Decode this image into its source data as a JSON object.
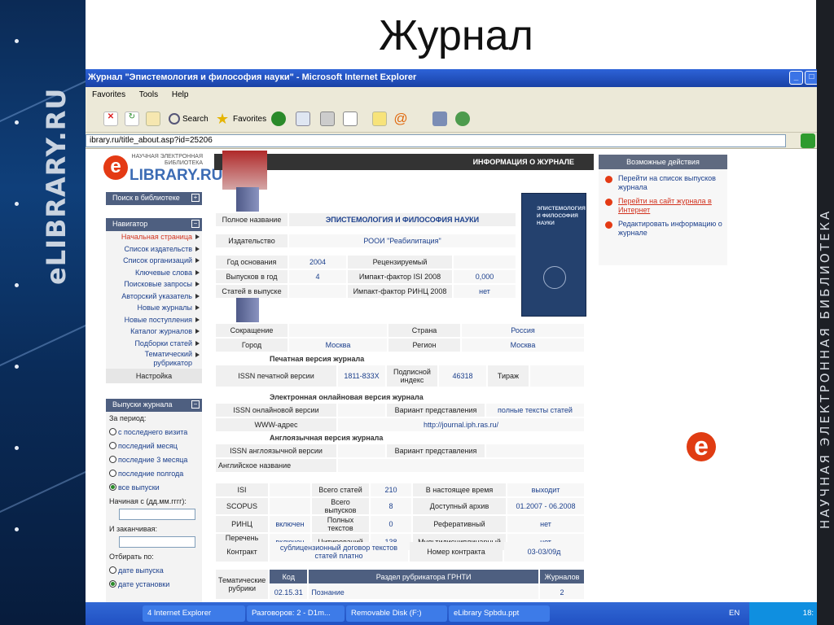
{
  "slide": {
    "title": "Журнал",
    "left_logo": "eLIBRARY.RU",
    "right_text": "НАУЧНАЯ ЭЛЕКТРОННАЯ БИБЛИОТЕКА"
  },
  "window": {
    "title": "Журнал \"Эпистемология и философия науки\" - Microsoft Internet Explorer",
    "menu": [
      "Favorites",
      "Tools",
      "Help"
    ],
    "toolbar": {
      "search": "Search",
      "favorites": "Favorites"
    },
    "address": "ibrary.ru/title_about.asp?id=25206"
  },
  "elibrary_logo": {
    "caption": "НАУЧНАЯ ЭЛЕКТРОННАЯ БИБЛИОТЕКА",
    "name": "LIBRARY.RU",
    "mark": "e"
  },
  "sidebar": {
    "search_label": "Поиск в библиотеке",
    "nav_label": "Навигатор",
    "nav_items": [
      {
        "label": "Начальная страница",
        "active": true
      },
      {
        "label": "Список издательств"
      },
      {
        "label": "Список организаций"
      },
      {
        "label": "Ключевые слова"
      },
      {
        "label": "Поисковые запросы"
      },
      {
        "label": "Авторский указатель"
      },
      {
        "label": "Новые журналы"
      },
      {
        "label": "Новые поступления"
      },
      {
        "label": "Каталог журналов"
      },
      {
        "label": "Подборки статей"
      },
      {
        "label": "Тематический рубрикатор"
      },
      {
        "label": "Настройка"
      }
    ],
    "issues_label": "Выпуски журнала",
    "period_label": "За период:",
    "periods": [
      "с последнего визита",
      "последний месяц",
      "последние 3 месяца",
      "последние полгода",
      "все выпуски"
    ],
    "start_label": "Начиная с (дд.мм.гггг):",
    "end_label": "И заканчивая:",
    "sort_label": "Отбирать по:",
    "sort_options": [
      "дате выпуска",
      "дате установки"
    ]
  },
  "info": {
    "band_title": "ИНФОРМАЦИЯ О ЖУРНАЛЕ",
    "full_name_label": "Полное название",
    "full_name": "ЭПИСТЕМОЛОГИЯ И ФИЛОСОФИЯ НАУКИ",
    "publisher_label": "Издательство",
    "publisher": "РООИ \"Реабилитация\"",
    "founded_label": "Год основания",
    "founded": "2004",
    "reviewed": "Рецензируемый",
    "issues_year_label": "Выпусков в год",
    "issues_year": "4",
    "isi_if_label": "Импакт-фактор ISI 2008",
    "isi_if": "0,000",
    "articles_label": "Статей в выпуске",
    "rinc_if_label": "Импакт-фактор РИНЦ 2008",
    "rinc_if": "нет"
  },
  "cover": {
    "title": "ЭПИСТЕМОЛОГИЯ И ФИЛОСОФИЯ НАУКИ"
  },
  "actions": {
    "head": "Возможные действия",
    "items": [
      {
        "label": "Перейти на список выпусков журнала"
      },
      {
        "label": "Перейти на сайт журнала в Интернет",
        "link": true
      },
      {
        "label": "Редактировать информацию о журнале"
      }
    ]
  },
  "details": {
    "abbr_label": "Сокращение",
    "country_label": "Страна",
    "country": "Россия",
    "city_label": "Город",
    "city": "Москва",
    "region_label": "Регион",
    "region": "Москва",
    "print_section": "Печатная версия журнала",
    "issn_print_label": "ISSN печатной версии",
    "issn_print": "1811-833X",
    "sub_index_label": "Подписной индекс",
    "sub_index": "46318",
    "circulation_label": "Тираж",
    "online_section": "Электронная онлайновая версия журнала",
    "issn_online_label": "ISSN онлайновой версии",
    "variant_label": "Вариант представления",
    "variant": "полные тексты статей",
    "www_label": "WWW-адрес",
    "www": "http://journal.iph.ras.ru/",
    "english_section": "Англоязычная версия журнала",
    "issn_en_label": "ISSN англоязычной версии",
    "variant_en_label": "Вариант представления",
    "en_title_label": "Английское название"
  },
  "indexing": {
    "rows": [
      [
        "ISI",
        "",
        "Всего статей",
        "210",
        "В настоящее время",
        "выходит"
      ],
      [
        "SCOPUS",
        "",
        "Всего выпусков",
        "8",
        "Доступный архив",
        "01.2007 - 06.2008"
      ],
      [
        "РИНЦ",
        "включен",
        "Полных текстов",
        "0",
        "Реферативный",
        "нет"
      ],
      [
        "Перечень ВАК",
        "включен",
        "Цитирований",
        "138",
        "Мультидисциплинарный",
        "нет"
      ]
    ],
    "contract_label": "Контракт",
    "contract_value": "сублицензионный договор текстов статей платно",
    "contract_no_label": "Номер контракта",
    "contract_no": "03-03/09д"
  },
  "rubric": {
    "label": "Тематические рубрики",
    "headers": [
      "Код",
      "Раздел рубрикатора ГРНТИ",
      "Журналов"
    ],
    "row": [
      "02.15.31",
      "Познание",
      "2"
    ]
  },
  "taskbar": {
    "tasks": [
      "4 Internet Explorer",
      "Разговоров: 2 - D1m...",
      "Removable Disk (F:)",
      "eLibrary Spbdu.ppt"
    ],
    "lang": "EN",
    "clock": "18:"
  }
}
